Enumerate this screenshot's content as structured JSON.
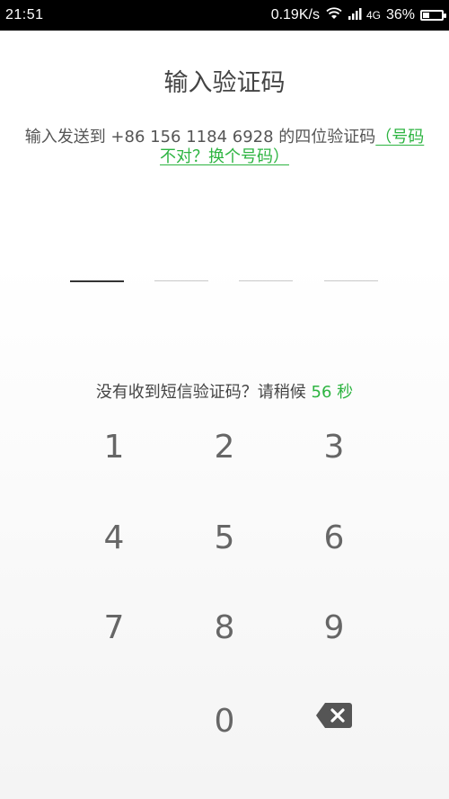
{
  "status_bar": {
    "time": "21:51",
    "network_speed": "0.19K/s",
    "network_type": "4G",
    "battery_percent": "36%",
    "battery_level": 0.36,
    "icons": [
      "wifi-icon",
      "signal-icon",
      "battery-icon"
    ]
  },
  "page": {
    "title": "输入验证码",
    "instruction_prefix": "输入发送到 +86 156 1184 6928 的四位验证码",
    "change_number_link": "（号码不对？换个号码）",
    "code_length": 4,
    "resend_prefix": "没有收到短信验证码？请稍候 ",
    "countdown_value": "56",
    "countdown_unit": " 秒"
  },
  "keypad": {
    "keys": [
      "1",
      "2",
      "3",
      "4",
      "5",
      "6",
      "7",
      "8",
      "9",
      "0"
    ],
    "backspace_icon": "backspace-icon"
  },
  "colors": {
    "accent": "#2db441",
    "status_bar_bg": "#000000",
    "text_primary": "#444444",
    "keypad_text": "#666666"
  }
}
